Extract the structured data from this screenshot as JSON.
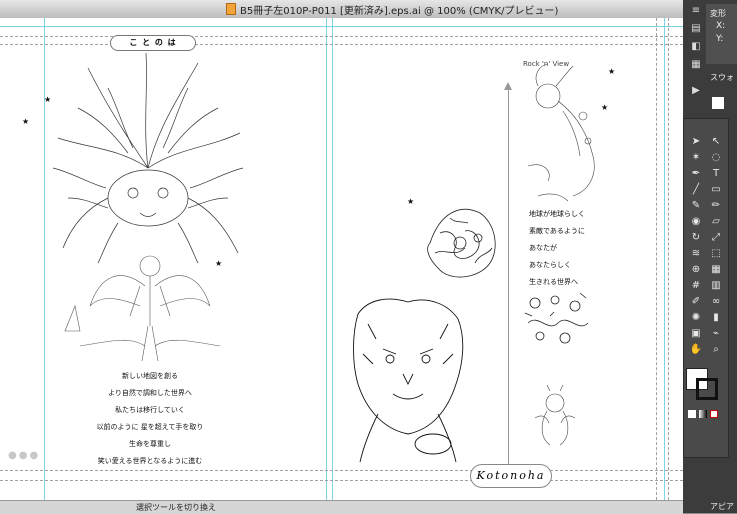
{
  "window": {
    "title": "B5冊子左010P-P011 [更新済み].eps.ai @ 100% (CMYK/プレビュー)"
  },
  "page": {
    "header_label": "こ と の は",
    "logo_text": "Kotonoha",
    "poem_left": [
      "新しい地図を創る",
      "より自然で調和した世界へ",
      "私たちは移行していく",
      "以前のように 星を超えて手を取り",
      "生命を尊重し",
      "笑い愛える世界となるように進む"
    ],
    "poem_right": [
      "地球が地球らしく",
      "素敵であるように",
      "あなたが",
      "あなたらしく",
      "生きれる世界へ"
    ],
    "star_glyph": "★",
    "drops": "●●●",
    "sketch_caption": "Rock 'n' View"
  },
  "status": {
    "text": "選択ツールを切り換え"
  },
  "panels": {
    "transform_tab": "変形",
    "swatch_tab": "スウォ",
    "appearance_tab": "アピア",
    "xy_labels": [
      "X:",
      "Y:"
    ]
  },
  "tools": [
    "selection-icon",
    "direct-selection-icon",
    "magic-wand-icon",
    "lasso-icon",
    "pen-icon",
    "type-icon",
    "line-icon",
    "rectangle-icon",
    "paintbrush-icon",
    "pencil-icon",
    "blob-brush-icon",
    "eraser-icon",
    "rotate-icon",
    "scale-icon",
    "width-icon",
    "free-transform-icon",
    "shape-builder-icon",
    "perspective-icon",
    "mesh-icon",
    "gradient-icon",
    "eyedropper-icon",
    "blend-icon",
    "symbol-sprayer-icon",
    "graph-icon",
    "artboard-icon",
    "slice-icon",
    "hand-icon",
    "zoom-icon"
  ],
  "colors": {
    "guide": "#7fd3e3",
    "dock": "#3c3c3c"
  }
}
